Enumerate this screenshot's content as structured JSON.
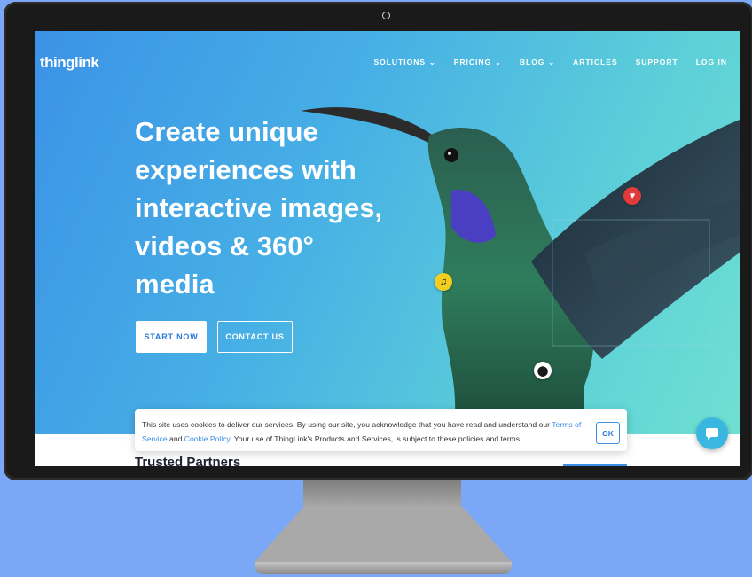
{
  "site": {
    "logo": "thinglink"
  },
  "nav": {
    "items": [
      {
        "label": "SOLUTIONS",
        "dropdown": true
      },
      {
        "label": "PRICING",
        "dropdown": true
      },
      {
        "label": "BLOG",
        "dropdown": true
      },
      {
        "label": "ARTICLES",
        "dropdown": false
      },
      {
        "label": "SUPPORT",
        "dropdown": false
      },
      {
        "label": "LOG IN",
        "dropdown": false
      }
    ]
  },
  "hero": {
    "headline": "Create unique experiences with interactive images, videos & 360° media",
    "start_label": "START NOW",
    "contact_label": "CONTACT US",
    "hotspots": [
      "heart-icon",
      "music-note-icon",
      "location-pin-icon"
    ]
  },
  "cookie": {
    "text_before": "This site uses cookies to deliver our services. By using our site, you acknowledge that you have read and understand our ",
    "terms_link": "Terms of Service",
    "middle": " and ",
    "policy_link": "Cookie Policy",
    "text_after": ". Your use of ThingLink's Products and Services, is subject to these policies and terms.",
    "ok_label": "OK"
  },
  "partners": {
    "heading": "Trusted Partners"
  },
  "colors": {
    "accent": "#3a8fe6",
    "background": "#7aa7f6",
    "heart": "#e23b3b",
    "music": "#f2cf1e"
  }
}
